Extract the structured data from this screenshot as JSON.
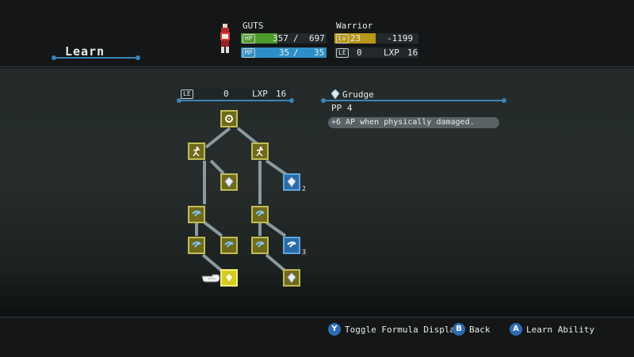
{
  "screen": {
    "title": "Learn"
  },
  "character": {
    "name": "GUTS",
    "job": "Warrior",
    "hp_label": "HP",
    "hp": "357",
    "hp_sep": "/",
    "hp_max": "697",
    "mp_label": "MP",
    "mp": "35",
    "mp_sep": "/",
    "mp_max": "35",
    "lv_label": "Lv",
    "lv": "23",
    "next": "-1199",
    "le_label": "LE",
    "le": "0",
    "lxp_label": "LXP",
    "lxp": "16"
  },
  "tree_header": {
    "le_label": "LE",
    "le": "0",
    "lxp_label": "LXP",
    "lxp": "16"
  },
  "ability": {
    "name": "Grudge",
    "pp": "PP 4",
    "description": "+6 AP when physically damaged."
  },
  "nodes": [
    {
      "id": "root",
      "icon": "gear-icon",
      "state": "learned"
    },
    {
      "id": "l1",
      "icon": "figure-icon",
      "state": "learned"
    },
    {
      "id": "r1",
      "icon": "figure-icon",
      "state": "learned"
    },
    {
      "id": "l1-crystal",
      "icon": "crystal-icon",
      "state": "learned"
    },
    {
      "id": "r1-crystal",
      "icon": "crystal-icon",
      "state": "available",
      "badge": "2"
    },
    {
      "id": "l2",
      "icon": "slash-icon",
      "state": "learned"
    },
    {
      "id": "r2",
      "icon": "slash-icon",
      "state": "learned"
    },
    {
      "id": "l3",
      "icon": "slash-icon",
      "state": "learned"
    },
    {
      "id": "l3b",
      "icon": "slash-icon",
      "state": "learned"
    },
    {
      "id": "r3",
      "icon": "slash-icon",
      "state": "learned"
    },
    {
      "id": "r3b",
      "icon": "slash-icon",
      "state": "available",
      "badge": "3"
    },
    {
      "id": "l4",
      "icon": "crystal-icon",
      "state": "selected"
    },
    {
      "id": "r4",
      "icon": "crystal-icon",
      "state": "learned"
    }
  ],
  "hints": [
    {
      "button": "Y",
      "label": "Toggle Formula Display"
    },
    {
      "button": "B",
      "label": "Back"
    },
    {
      "button": "A",
      "label": "Learn Ability"
    }
  ],
  "colors": {
    "accent": "#3a84b6",
    "node": "#6f6a1c",
    "node_available": "#2a6aa6",
    "node_selected": "#d8cc20",
    "hp": "#4f9a2c",
    "mp": "#2e8fc8",
    "lv": "#b89618"
  }
}
